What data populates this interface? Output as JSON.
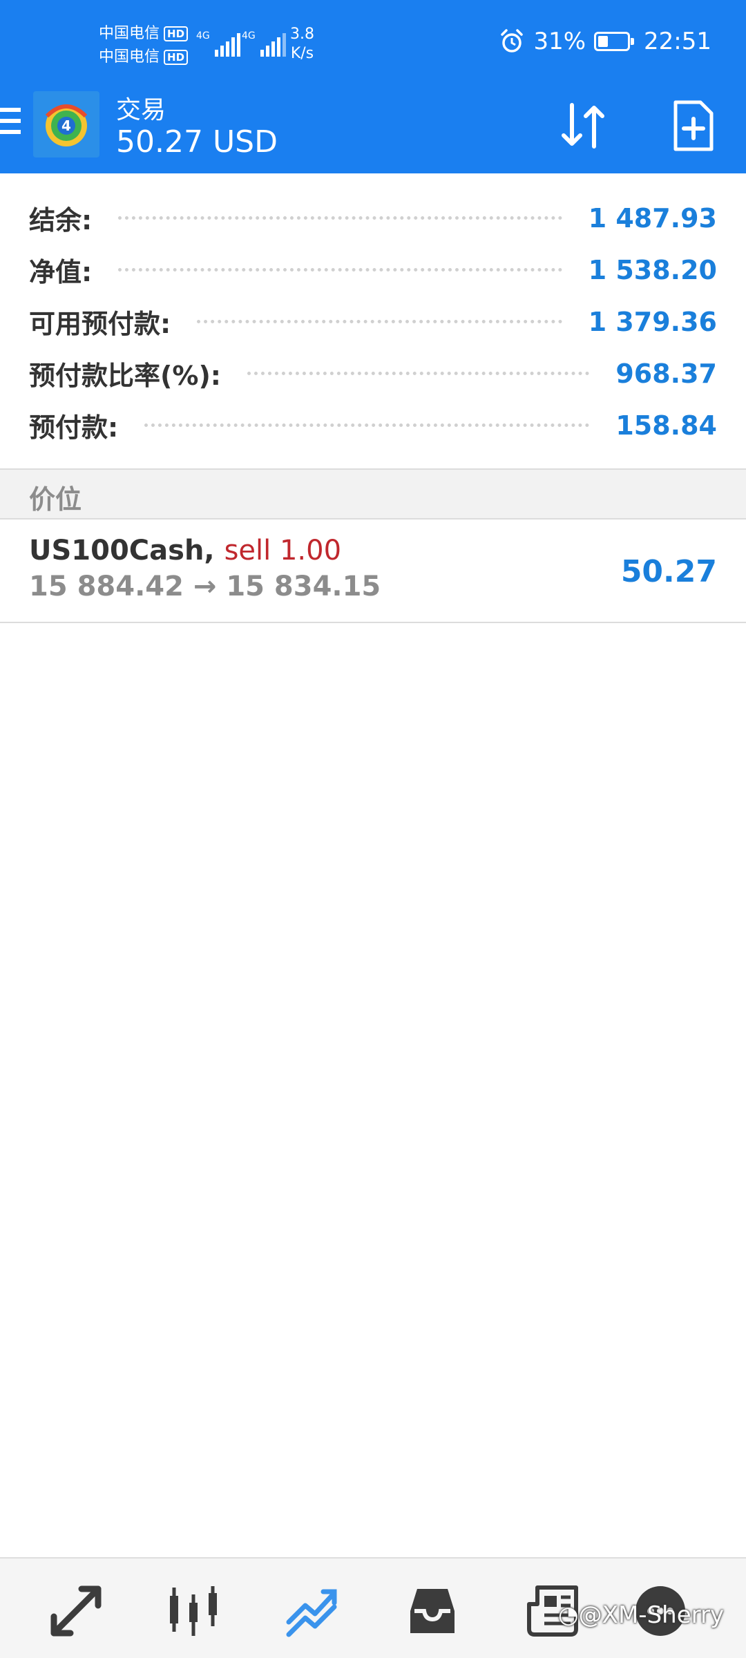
{
  "status_bar": {
    "carrier_1": "中国电信",
    "carrier_2": "中国电信",
    "hd_badge": "HD",
    "network_1": "4G",
    "network_2": "4G",
    "speed_value": "3.8",
    "speed_unit": "K/s",
    "battery": "31%",
    "battery_level_percent": 31,
    "time": "22:51",
    "icons": [
      "alarm-icon",
      "battery-saver-icon",
      "signal-icon"
    ]
  },
  "app_bar": {
    "title": "交易",
    "subtitle": "50.27 USD",
    "icons": [
      "menu-icon",
      "metatrader-logo",
      "sort-icon",
      "new-order-icon"
    ]
  },
  "account_summary": [
    {
      "label": "结余:",
      "value": "1 487.93"
    },
    {
      "label": "净值:",
      "value": "1 538.20"
    },
    {
      "label": "可用预付款:",
      "value": "1 379.36"
    },
    {
      "label": "预付款比率(%):",
      "value": "968.37"
    },
    {
      "label": "预付款:",
      "value": "158.84"
    }
  ],
  "positions_section": {
    "title": "价位"
  },
  "positions": [
    {
      "symbol": "US100Cash,",
      "side": "sell 1.00",
      "prices": "15 884.42 → 15 834.15",
      "profit": "50.27"
    }
  ],
  "bottom_nav": {
    "items": [
      "quotes-icon",
      "chart-icon",
      "trade-icon",
      "history-icon",
      "news-icon",
      "messages-icon"
    ],
    "active_index": 2
  },
  "watermark": "@XM-Sherry",
  "colors": {
    "accent": "#1a7ff0",
    "value_blue": "#1a7fdb",
    "sell_red": "#c0272d",
    "label_dark": "#333333",
    "muted_gray": "#8c8c8c"
  }
}
